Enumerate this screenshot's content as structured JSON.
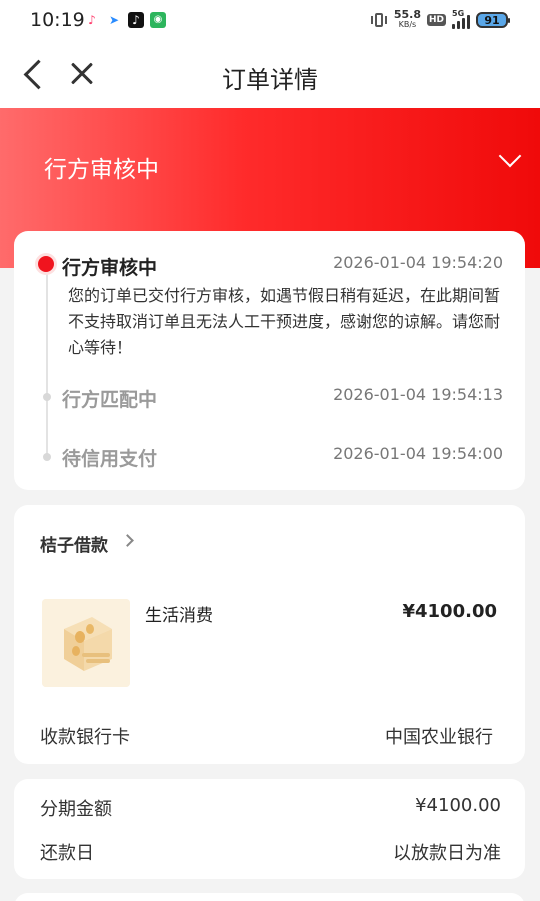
{
  "status_bar": {
    "time": "10:19",
    "net_speed_value": "55.8",
    "net_speed_unit": "KB/s",
    "hd_label": "HD",
    "signal_label": "5G",
    "battery": "91"
  },
  "nav": {
    "title": "订单详情"
  },
  "banner": {
    "status": "行方审核中"
  },
  "timeline": {
    "steps": [
      {
        "label": "行方审核中",
        "time": "2026-01-04 19:54:20"
      },
      {
        "label": "行方匹配中",
        "time": "2026-01-04 19:54:13"
      },
      {
        "label": "待信用支付",
        "time": "2026-01-04 19:54:00"
      }
    ],
    "description": "您的订单已交付行方审核，如遇节假日稍有延迟，在此期间暂不支持取消订单且无法人工干预进度，感谢您的谅解。请您耐心等待！"
  },
  "product": {
    "merchant": "桔子借款",
    "name": "生活消费",
    "price": "¥4100.00",
    "bank_label": "收款银行卡",
    "bank_value": "中国农业银行"
  },
  "installment": {
    "amount_label": "分期金额",
    "amount_value": "¥4100.00",
    "repay_label": "还款日",
    "repay_value": "以放款日为准"
  },
  "colors": {
    "accent": "#f0141e",
    "banner_start": "#ff6b6b",
    "banner_end": "#f00a0a"
  }
}
